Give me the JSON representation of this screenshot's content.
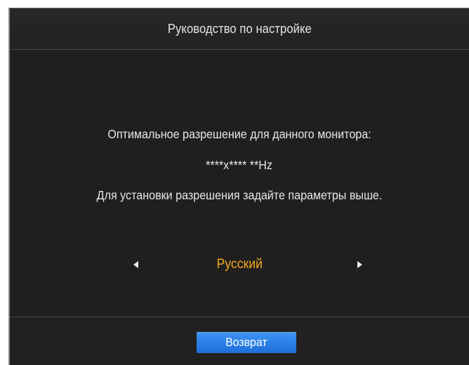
{
  "osd": {
    "title": "Руководство по настройке",
    "message_line1": "Оптимальное разрешение для данного монитора:",
    "resolution": "****x**** **Hz",
    "message_line2": "Для установки разрешения задайте параметры выше.",
    "language": {
      "value": "Русский",
      "left_icon": "triangle-left-icon",
      "right_icon": "triangle-right-icon"
    },
    "return_label": "Возврат"
  },
  "colors": {
    "background": "#211f1e",
    "text": "#e8e8e8",
    "selected_value": "#f2a920",
    "button": "#2a7fe6"
  }
}
